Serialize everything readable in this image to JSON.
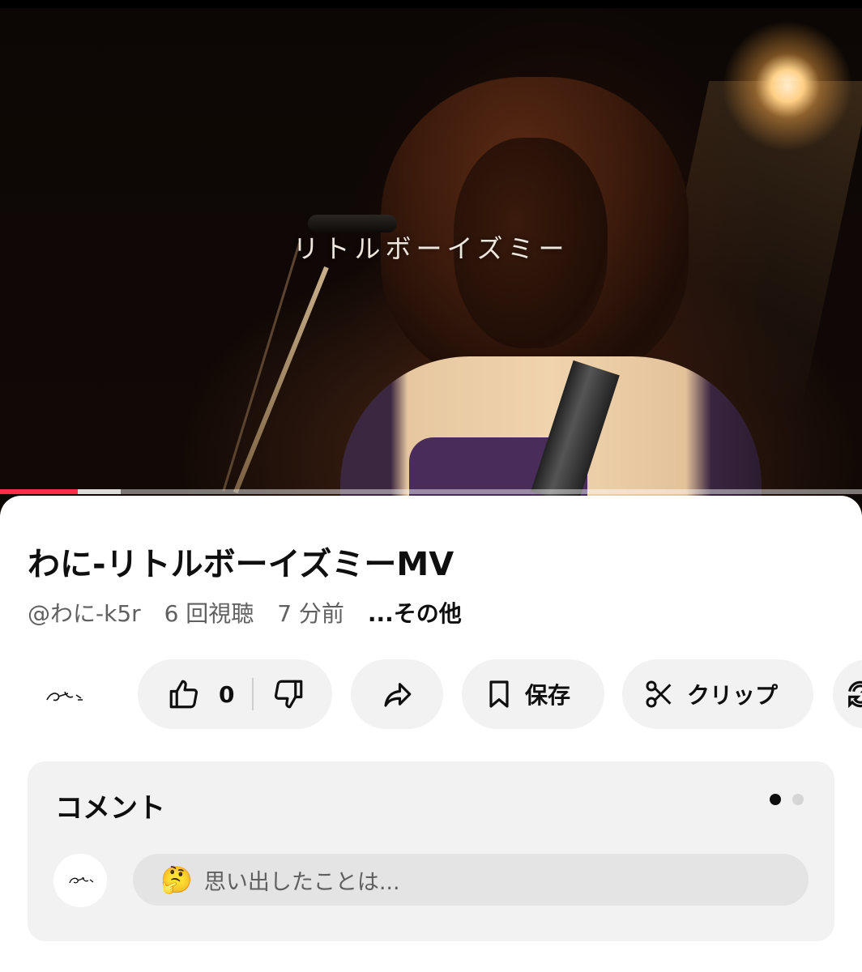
{
  "video": {
    "overlay_title": "リトルボーイズミー",
    "progress": {
      "played_fraction": 0.09,
      "buffered_fraction": 0.14,
      "played_color": "#ff2b4a"
    }
  },
  "info": {
    "title": "わに-リトルボーイズミーMV",
    "channel": "@わに-k5r",
    "views": "6 回視聴",
    "time_ago": "7 分前",
    "more": "...その他"
  },
  "actions": {
    "like_count": "0",
    "save_label": "保存",
    "clip_label": "クリップ",
    "icons": [
      "thumbs-up-icon",
      "thumbs-down-icon",
      "share-icon",
      "bookmark-icon",
      "scissors-icon",
      "remix-icon"
    ]
  },
  "comments": {
    "title": "コメント",
    "emoji": "🤔",
    "placeholder": "思い出したことは..."
  }
}
